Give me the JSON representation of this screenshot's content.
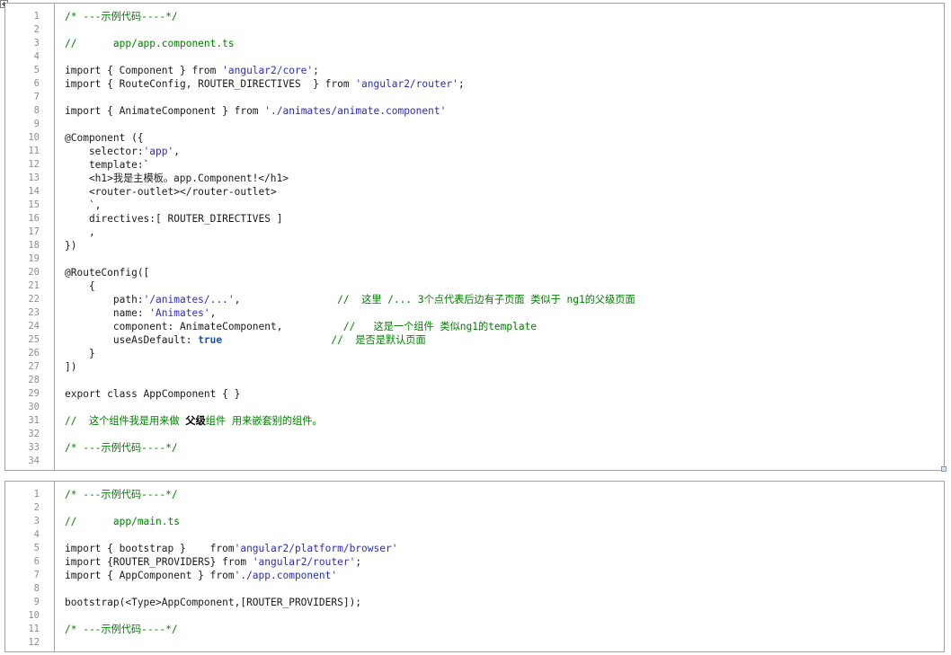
{
  "blocks": [
    {
      "name": "code-block-app-component",
      "lines": [
        [
          [
            "c",
            "/* ---示例代码----*/"
          ]
        ],
        [],
        [
          [
            "c",
            "//      app/app.component.ts"
          ]
        ],
        [],
        [
          [
            "p",
            "import { Component } from "
          ],
          [
            "s",
            "'angular2/core'"
          ],
          [
            "p",
            ";"
          ]
        ],
        [
          [
            "p",
            "import { RouteConfig, ROUTER_DIRECTIVES  } from "
          ],
          [
            "s",
            "'angular2/router'"
          ],
          [
            "p",
            ";"
          ]
        ],
        [],
        [
          [
            "p",
            "import { AnimateComponent } from "
          ],
          [
            "s",
            "'./animates/animate.component'"
          ]
        ],
        [],
        [
          [
            "p",
            "@Component ({"
          ]
        ],
        [
          [
            "p",
            "    selector:"
          ],
          [
            "s",
            "'app'"
          ],
          [
            "p",
            ","
          ]
        ],
        [
          [
            "p",
            "    template:`"
          ]
        ],
        [
          [
            "p",
            "    <h1>我是主模板。app.Component!</h1>"
          ]
        ],
        [
          [
            "p",
            "    <router-outlet></router-outlet>"
          ]
        ],
        [
          [
            "p",
            "    `,"
          ]
        ],
        [
          [
            "p",
            "    directives:[ ROUTER_DIRECTIVES ]"
          ]
        ],
        [
          [
            "p",
            "    ,"
          ]
        ],
        [
          [
            "p",
            "})"
          ]
        ],
        [],
        [
          [
            "p",
            "@RouteConfig(["
          ]
        ],
        [
          [
            "p",
            "    {"
          ]
        ],
        [
          [
            "p",
            "        path:"
          ],
          [
            "s",
            "'/animates/...'"
          ],
          [
            "p",
            ",                "
          ],
          [
            "c",
            "//  这里 /... 3个点代表后边有子页面 类似于 ng1的父级页面"
          ]
        ],
        [
          [
            "p",
            "        name: "
          ],
          [
            "s",
            "'Animates'"
          ],
          [
            "p",
            ","
          ]
        ],
        [
          [
            "p",
            "        component: AnimateComponent,          "
          ],
          [
            "c",
            "//   这是一个组件 类似ng1的template"
          ]
        ],
        [
          [
            "p",
            "        useAsDefault: "
          ],
          [
            "k",
            "true"
          ],
          [
            "p",
            "                  "
          ],
          [
            "c",
            "//  是否是默认页面"
          ]
        ],
        [
          [
            "p",
            "    }"
          ]
        ],
        [
          [
            "p",
            "])"
          ]
        ],
        [],
        [
          [
            "p",
            "export class AppComponent { }"
          ]
        ],
        [],
        [
          [
            "c",
            "//  这个组件我是用来做 "
          ],
          [
            "b",
            "父级"
          ],
          [
            "c",
            "组件 用来嵌套别的组件。"
          ]
        ],
        [],
        [
          [
            "c",
            "/* ---示例代码----*/"
          ]
        ],
        []
      ]
    },
    {
      "name": "code-block-main",
      "lines": [
        [
          [
            "c",
            "/* ---示例代码----*/"
          ]
        ],
        [],
        [
          [
            "c",
            "//      app/main.ts"
          ]
        ],
        [],
        [
          [
            "p",
            "import { bootstrap }    from"
          ],
          [
            "s",
            "'angular2/platform/browser'"
          ]
        ],
        [
          [
            "p",
            "import {ROUTER_PROVIDERS} from "
          ],
          [
            "s",
            "'angular2/router'"
          ],
          [
            "p",
            ";"
          ]
        ],
        [
          [
            "p",
            "import { AppComponent } from"
          ],
          [
            "s",
            "'./app.component'"
          ]
        ],
        [],
        [
          [
            "p",
            "bootstrap(<Type>AppComponent,[ROUTER_PROVIDERS]);"
          ]
        ],
        [],
        [
          [
            "c",
            "/* ---示例代码----*/"
          ]
        ],
        []
      ]
    }
  ]
}
